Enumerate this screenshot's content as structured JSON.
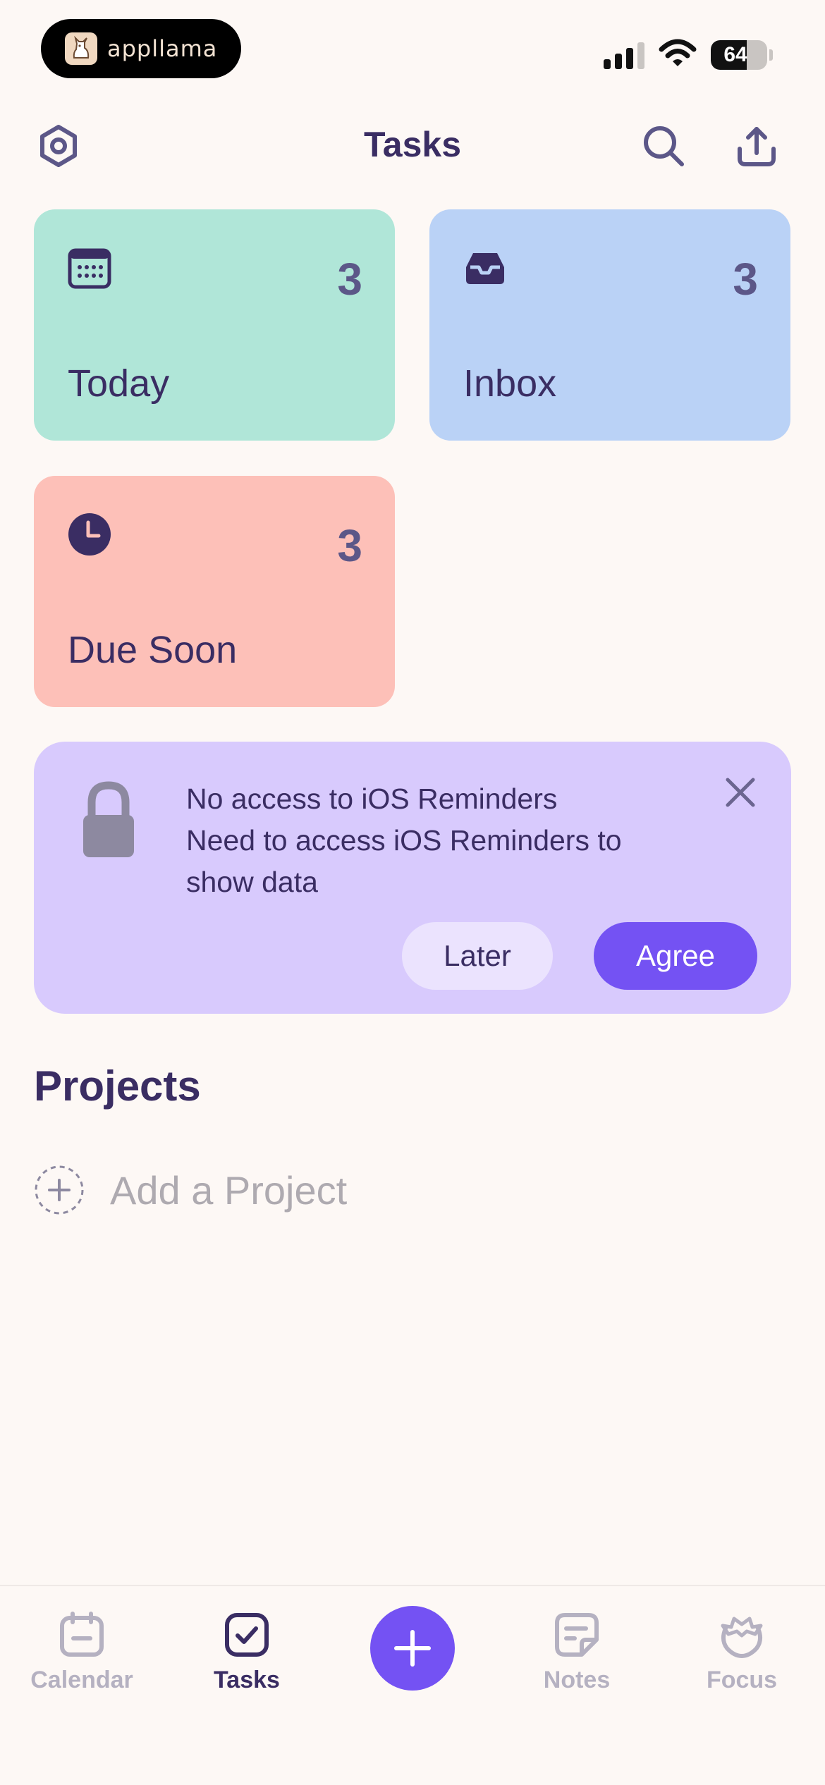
{
  "status_bar": {
    "app_name": "appllama",
    "battery": "64",
    "battery_level": 0.64
  },
  "header": {
    "title": "Tasks",
    "settings_icon": "settings-icon",
    "search_icon": "search-icon",
    "share_icon": "share-icon"
  },
  "cards": {
    "today": {
      "label": "Today",
      "count": "3",
      "color": "#b0e6d8"
    },
    "inbox": {
      "label": "Inbox",
      "count": "3",
      "color": "#bad2f6"
    },
    "due_soon": {
      "label": "Due Soon",
      "count": "3",
      "color": "#fdc0b8"
    }
  },
  "banner": {
    "title": "No access to iOS Reminders",
    "message": "Need to access iOS Reminders to show data",
    "later_label": "Later",
    "agree_label": "Agree",
    "color": "#d8cafd"
  },
  "projects": {
    "title": "Projects",
    "add_label": "Add a Project"
  },
  "tab_bar": {
    "calendar": "Calendar",
    "tasks": "Tasks",
    "notes": "Notes",
    "focus": "Focus",
    "active": "Tasks",
    "accent": "#7452f3"
  }
}
